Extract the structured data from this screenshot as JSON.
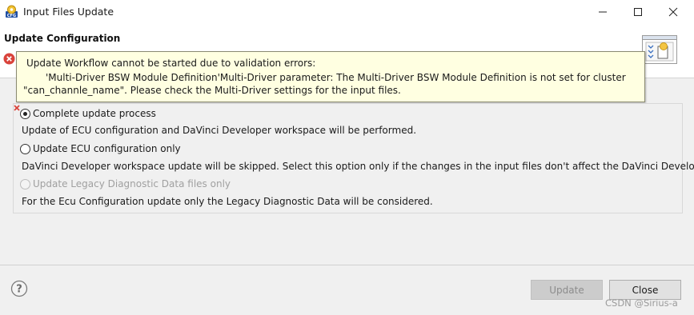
{
  "window": {
    "title": "Input Files Update",
    "icon_text": "CFG"
  },
  "header": {
    "title": "Update Configuration"
  },
  "tooltip": {
    "line1": "Update Workflow cannot be started due to validation errors:",
    "line2": "'Multi-Driver BSW Module Definition'Multi-Driver parameter: The Multi-Driver BSW Module Definition is not set for cluster",
    "line3": "\"can_channle_name\". Please check the Multi-Driver settings for the input files."
  },
  "options": [
    {
      "label": "Complete update process",
      "checked": true,
      "enabled": true,
      "description": "Update of ECU configuration and DaVinci Developer workspace will be performed."
    },
    {
      "label": "Update ECU configuration only",
      "checked": false,
      "enabled": true,
      "description": "DaVinci Developer workspace update will be skipped. Select this option only if the changes in the input files don't affect the DaVinci Develope"
    },
    {
      "label": "Update Legacy Diagnostic Data files only",
      "checked": false,
      "enabled": false,
      "description": "For the Ecu Configuration update only the Legacy Diagnostic Data will be considered."
    }
  ],
  "buttons": {
    "update": "Update",
    "close": "Close"
  },
  "watermark": "CSDN @Sirius-a",
  "colors": {
    "tooltip_bg": "#ffffe1",
    "error_red": "#d9433b",
    "disabled_text": "#a0a0a0"
  }
}
